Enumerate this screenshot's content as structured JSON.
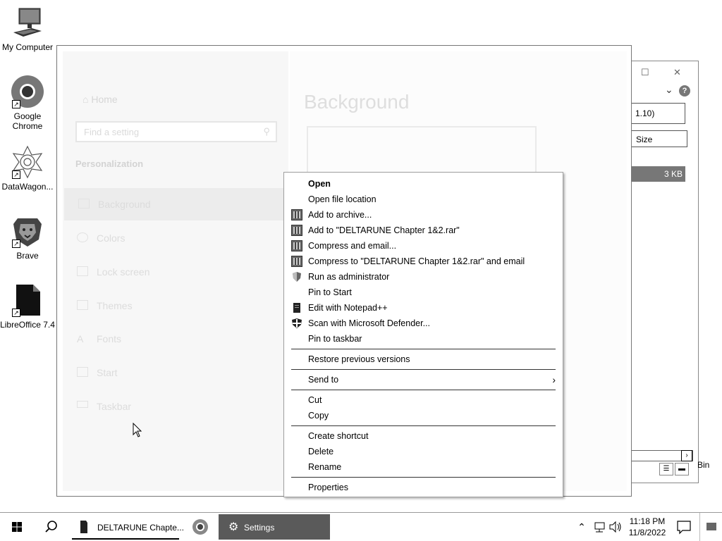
{
  "desktop_icons": [
    {
      "label": "My Computer"
    },
    {
      "label": "Google Chrome"
    },
    {
      "label": "DataWagon..."
    },
    {
      "label": "Brave"
    },
    {
      "label": "LibreOffice 7.4"
    }
  ],
  "explorer": {
    "address_fragment": "1.10)",
    "column_header": "Size",
    "selected_size": "3 KB",
    "help": "?",
    "recycle_bin_fragment": "Bin"
  },
  "settings": {
    "nav": {
      "home": "Home",
      "search_placeholder": "Find a setting",
      "section": "Personalization",
      "items": [
        {
          "label": "Background"
        },
        {
          "label": "Colors"
        },
        {
          "label": "Lock screen"
        },
        {
          "label": "Themes"
        },
        {
          "label": "Fonts"
        },
        {
          "label": "Start"
        },
        {
          "label": "Taskbar"
        }
      ]
    },
    "main": {
      "title": "Background"
    }
  },
  "context_menu": {
    "groups": [
      [
        "Open",
        "Open file location",
        "Add to archive...",
        "Add to \"DELTARUNE Chapter 1&2.rar\"",
        "Compress and email...",
        "Compress to \"DELTARUNE Chapter 1&2.rar\" and email",
        "Run as administrator",
        "Pin to Start",
        "Edit with Notepad++",
        "Scan with Microsoft Defender...",
        "Pin to taskbar"
      ],
      [
        "Restore previous versions"
      ],
      [
        "Send to"
      ],
      [
        "Cut",
        "Copy"
      ],
      [
        "Create shortcut",
        "Delete",
        "Rename"
      ],
      [
        "Properties"
      ]
    ]
  },
  "taskbar": {
    "tasks": [
      {
        "label": "DELTARUNE Chapte..."
      },
      {
        "label": "Settings"
      }
    ],
    "time": "11:18 PM",
    "date": "11/8/2022"
  }
}
